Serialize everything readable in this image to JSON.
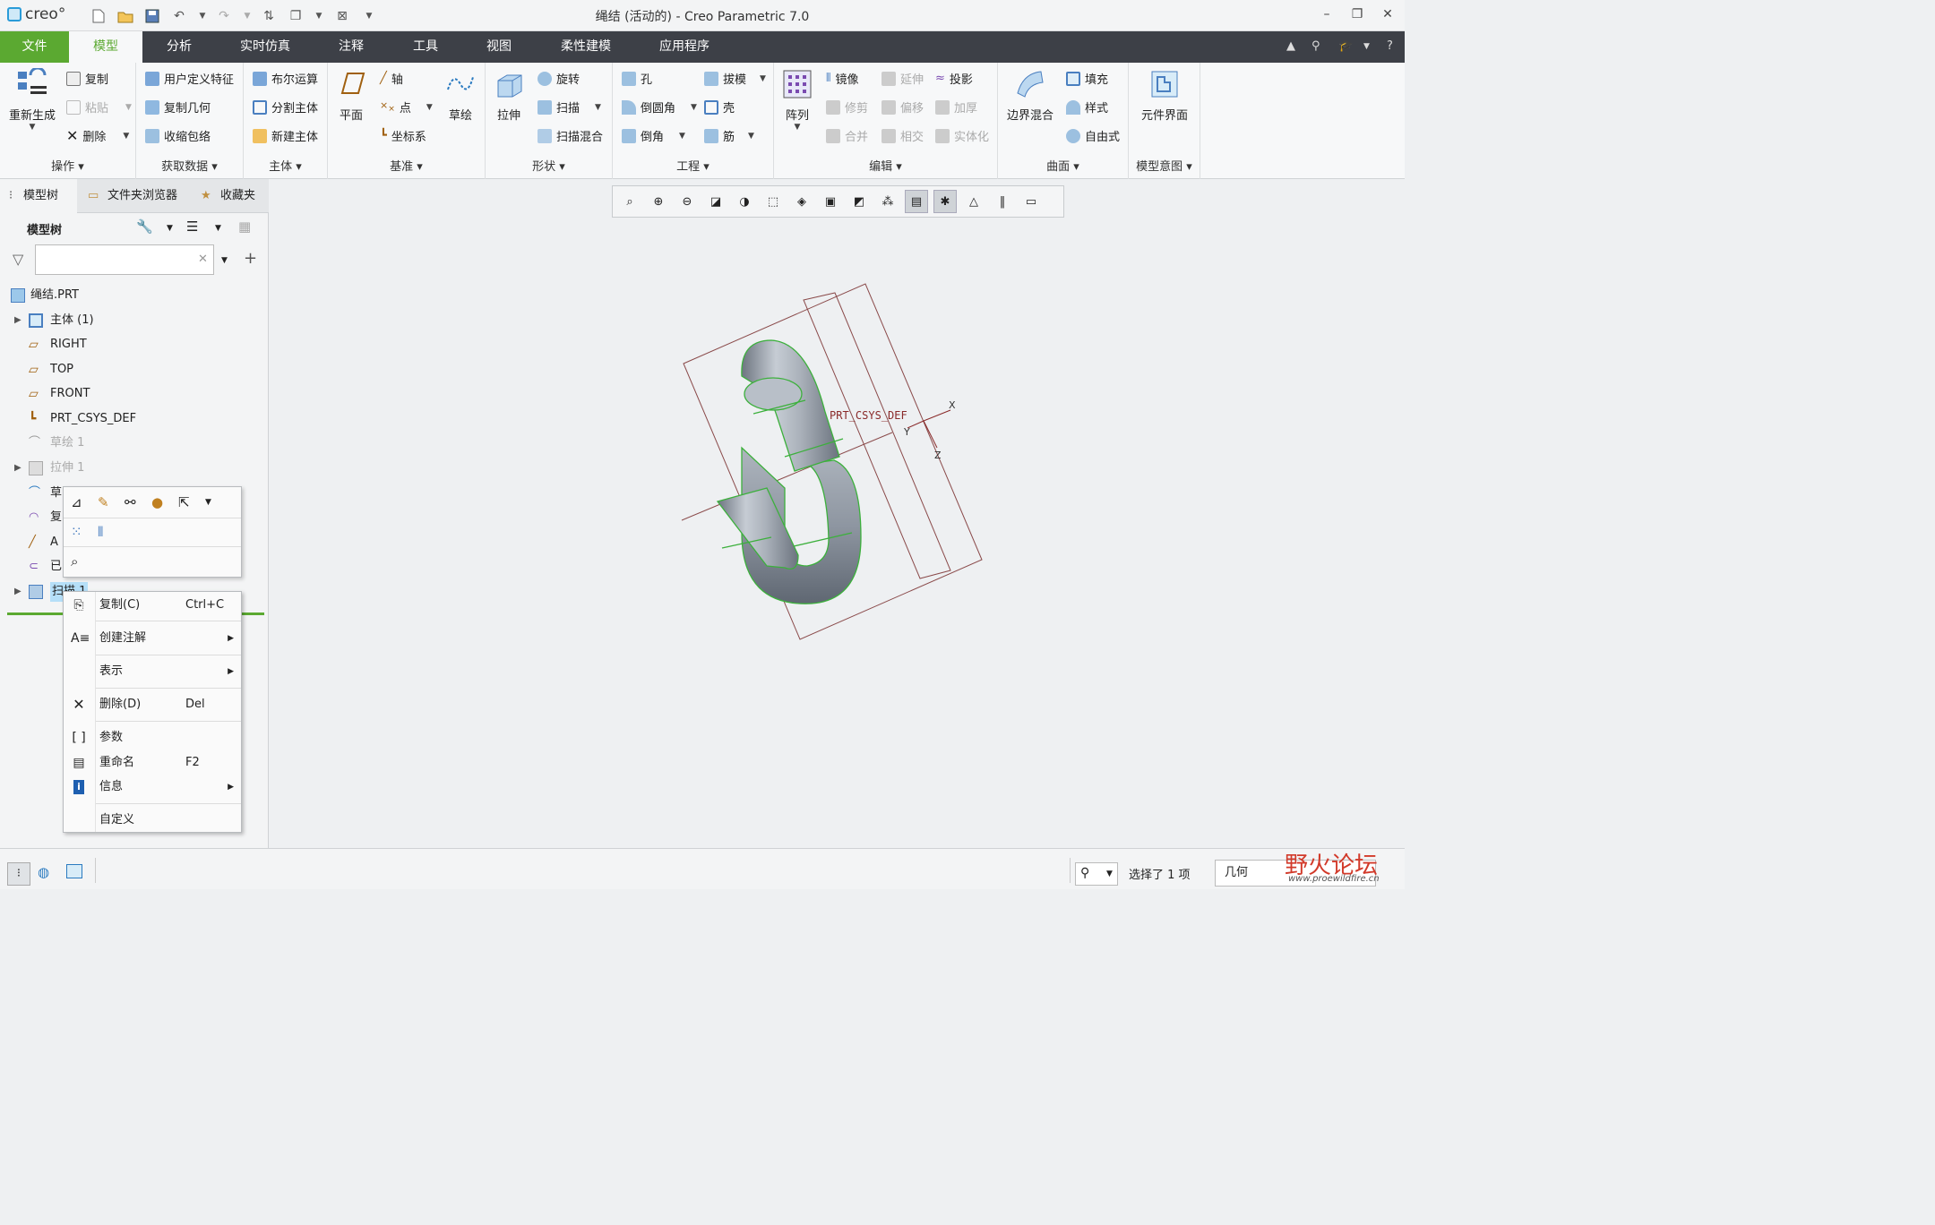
{
  "app": {
    "logo_text": "creo°",
    "window_title": "绳结 (活动的) - Creo Parametric 7.0"
  },
  "tabs": [
    "文件",
    "模型",
    "分析",
    "实时仿真",
    "注释",
    "工具",
    "视图",
    "柔性建模",
    "应用程序"
  ],
  "ribbon": {
    "operations": {
      "label": "操作 ▾",
      "regen": "重新生成",
      "copy": "复制",
      "paste": "粘贴",
      "delete": "删除"
    },
    "getdata": {
      "label": "获取数据 ▾",
      "udf": "用户定义特征",
      "copygeom": "复制几何",
      "shrinkwrap": "收缩包络"
    },
    "body": {
      "label": "主体 ▾",
      "boolean": "布尔运算",
      "split": "分割主体",
      "newbody": "新建主体"
    },
    "datum": {
      "label": "基准 ▾",
      "plane": "平面",
      "axis": "轴",
      "point": "点",
      "csys": "坐标系",
      "sketch": "草绘"
    },
    "shapes": {
      "label": "形状 ▾",
      "extrude": "拉伸",
      "revolve": "旋转",
      "sweep": "扫描",
      "sweptblend": "扫描混合"
    },
    "engineering": {
      "label": "工程 ▾",
      "hole": "孔",
      "round": "倒圆角",
      "chamfer": "倒角",
      "draft": "拔模",
      "shell": "壳",
      "rib": "筋"
    },
    "editing": {
      "label": "编辑 ▾",
      "pattern": "阵列",
      "mirror": "镜像",
      "extend": "延伸",
      "project": "投影",
      "trim": "修剪",
      "offset": "偏移",
      "thicken": "加厚",
      "merge": "合并",
      "intersect": "相交",
      "solidify": "实体化"
    },
    "surfaces": {
      "label": "曲面 ▾",
      "boundary": "边界混合",
      "fill": "填充",
      "style": "样式",
      "freestyle": "自由式"
    },
    "intent": {
      "label": "模型意图 ▾",
      "component": "元件界面"
    }
  },
  "nav": {
    "tab_tree": "模型树",
    "tab_folder": "文件夹浏览器",
    "tab_fav": "收藏夹",
    "tree_title": "模型树",
    "search_value": ""
  },
  "tree": {
    "root": "绳结.PRT",
    "items": [
      "主体 (1)",
      "RIGHT",
      "TOP",
      "FRONT",
      "PRT_CSYS_DEF",
      "草绘 1",
      "拉伸 1",
      "草",
      "复",
      "A",
      "已",
      "扫描 1"
    ]
  },
  "viewport": {
    "csys_label": "PRT_CSYS_DEF",
    "axis_x": "X",
    "axis_y": "Y",
    "axis_z": "Z"
  },
  "ctxmenu": {
    "copy": "复制(C)",
    "copy_shortcut": "Ctrl+C",
    "annot": "创建注解",
    "display": "表示",
    "delete": "删除(D)",
    "delete_shortcut": "Del",
    "params": "参数",
    "rename": "重命名",
    "rename_shortcut": "F2",
    "info": "信息",
    "custom": "自定义"
  },
  "status": {
    "selected": "选择了 1 项",
    "filter": "几何",
    "watermark": "野火论坛",
    "watermark_url": "www.proewildfire.cn"
  },
  "colors": {
    "accent_green": "#5ba931",
    "tabbar": "#3d4047",
    "selection": "#b5dff8"
  }
}
